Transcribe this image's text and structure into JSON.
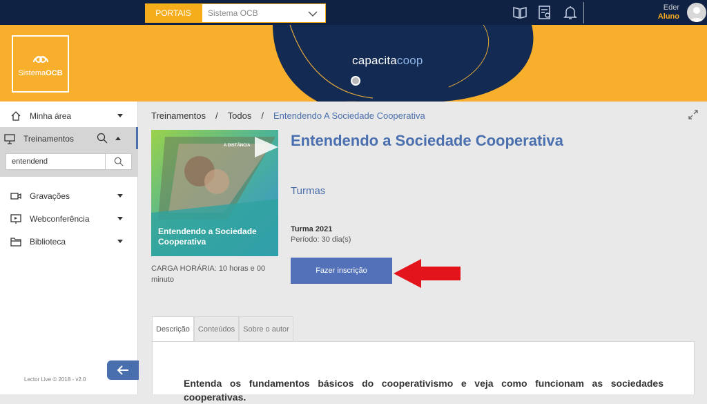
{
  "topbar": {
    "portais_label": "PORTAIS",
    "portal_selected": "Sistema OCB",
    "user_name": "Eder",
    "user_role": "Aluno"
  },
  "banner": {
    "logo_text_prefix": "Sistema",
    "logo_text_bold": "OCB",
    "brand_capacita": "capacita",
    "brand_coop": "coop"
  },
  "sidebar": {
    "items": [
      {
        "label": "Minha área",
        "icon": "home-icon"
      },
      {
        "label": "Treinamentos",
        "icon": "presentation-icon"
      },
      {
        "label": "Gravações",
        "icon": "video-camera-icon"
      },
      {
        "label": "Webconferência",
        "icon": "monitor-play-icon"
      },
      {
        "label": "Biblioteca",
        "icon": "folder-icon"
      }
    ],
    "search_value": "entendend",
    "footer": "Lector Live © 2018 - v2.0"
  },
  "breadcrumb": {
    "items": [
      "Treinamentos",
      "Todos",
      "Entendendo A Sociedade Cooperativa"
    ],
    "separator": "/"
  },
  "course": {
    "image_title": "Entendendo a Sociedade Cooperativa",
    "image_badge": "A DISTÂNCIA",
    "workload_label": "CARGA HORÁRIA:",
    "workload_value": "10 horas e 00 minuto",
    "title": "Entendendo a Sociedade Cooperativa",
    "turmas_heading": "Turmas",
    "turma_name": "Turma 2021",
    "turma_period": "Período: 30 dia(s)",
    "enroll_label": "Fazer inscrição"
  },
  "tabs": [
    "Descrição",
    "Conteúdos",
    "Sobre o autor"
  ],
  "description": "Entenda os fundamentos básicos do cooperativismo e veja como funcionam as sociedades cooperativas.",
  "colors": {
    "topbar": "#0f2244",
    "accent_orange": "#f7af2c",
    "primary_blue": "#4a6fae",
    "annotation_red": "#e3141b"
  }
}
